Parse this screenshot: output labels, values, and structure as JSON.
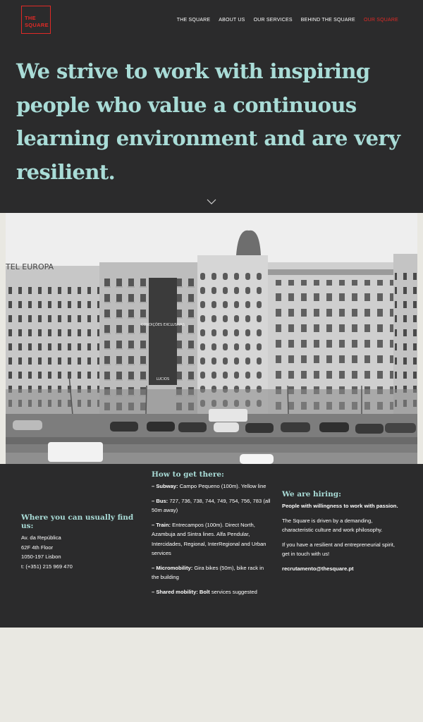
{
  "header": {
    "logo": [
      "THE",
      "SQUARE"
    ],
    "nav": [
      "THE SQUARE",
      "ABOUT US",
      "OUR SERVICES",
      "BEHIND THE SQUARE",
      "OUR SQUARE"
    ],
    "active_color": "#e12a26"
  },
  "hero": {
    "headline": "We strive to work with inspiring people who value a continuous learning environment and are very resilient.",
    "scroll_icon": "chevron-down-icon"
  },
  "photo": {
    "sign_hotel": "TEL EUROPA",
    "banner_text": "CONDIÇÕES EXCLUSIVAS",
    "banner_sub": "LUCIOS"
  },
  "location": {
    "title": "Where you can usually find us:",
    "lines": [
      "Av. da República",
      "62F 4th Floor",
      "1050-197 Lisbon",
      "t: (+351) 215 969 470"
    ]
  },
  "directions": {
    "title": "How to get there:",
    "items": [
      {
        "label": "– Subway:",
        "text": " Campo Pequeno (100m). Yellow line"
      },
      {
        "label": "– Bus:",
        "text": " 727, 736, 738, 744, 749, 754, 756, 783 (all 50m away)"
      },
      {
        "label": "– Train:",
        "text": " Entrecampos (100m). Direct North, Azambuja and Sintra lines. Alfa Pendular, Intercidades, Regional, InterRegional and Urban services"
      },
      {
        "label": "– Micromobility:",
        "text": " Gira bikes (50m), bike rack in the building"
      },
      {
        "label": "– Shared mobility: Bolt",
        "text": " services suggested"
      }
    ]
  },
  "hiring": {
    "title": "We are hiring:",
    "lead": "People with willingness to work with passion.",
    "p1": "The Square is driven by a demanding, characteristic culture and work philosophy.",
    "p2": "If you have a resilient and entrepreneurial spirit, get in touch with us!",
    "email": "recrutamento@thesquare.pt"
  }
}
